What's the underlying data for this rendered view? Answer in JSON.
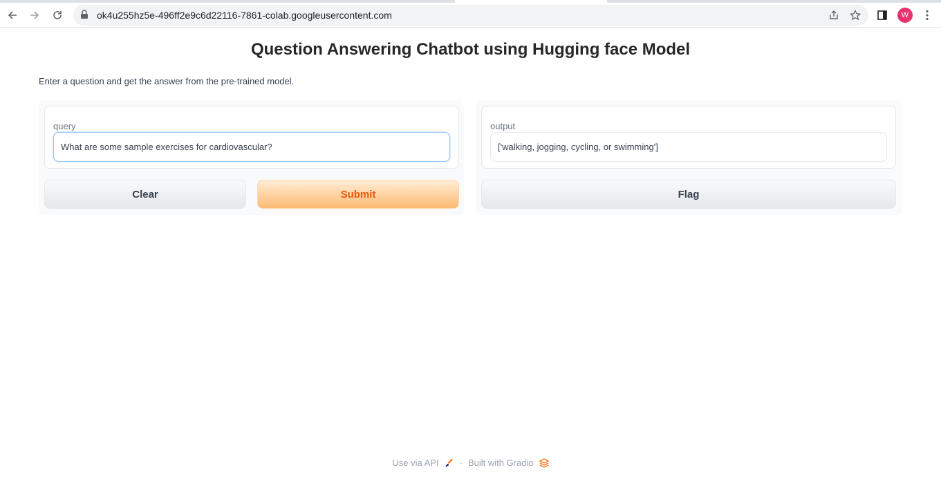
{
  "browser": {
    "url": "ok4u255hz5e-496ff2e9c6d22116-7861-colab.googleusercontent.com",
    "avatar_letter": "W",
    "avatar_color": "#e8336f"
  },
  "page": {
    "title": "Question Answering Chatbot using Hugging face Model",
    "description": "Enter a question and get the answer from the pre-trained model."
  },
  "input_panel": {
    "label": "query",
    "value": "What are some sample exercises for cardiovascular?",
    "clear_label": "Clear",
    "submit_label": "Submit"
  },
  "output_panel": {
    "label": "output",
    "value": "['walking, jogging, cycling, or swimming']",
    "flag_label": "Flag"
  },
  "footer": {
    "api_label": "Use via API",
    "separator": "·",
    "built_label": "Built with Gradio"
  },
  "colors": {
    "accent": "#ea580c",
    "submit_gradient_start": "#ffedd5",
    "submit_gradient_end": "#fdba74"
  }
}
